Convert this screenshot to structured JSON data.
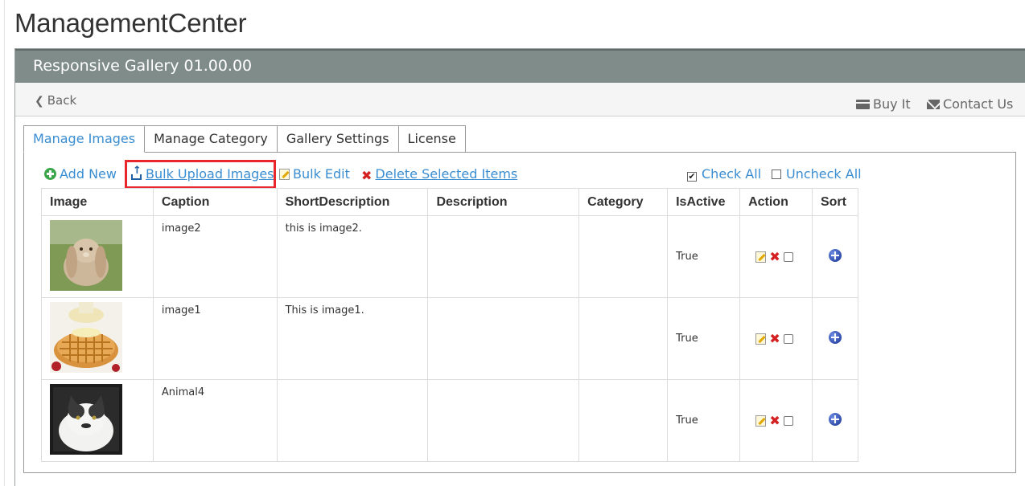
{
  "app": {
    "title": "ManagementCenter"
  },
  "module": {
    "title": "Responsive Gallery 01.00.00"
  },
  "toolbar": {
    "back": "Back",
    "buy": "Buy It",
    "contact": "Contact Us"
  },
  "tabs": [
    {
      "label": "Manage Images",
      "active": true
    },
    {
      "label": "Manage Category",
      "active": false
    },
    {
      "label": "Gallery Settings",
      "active": false
    },
    {
      "label": "License",
      "active": false
    }
  ],
  "actions": {
    "add_new": "Add New",
    "bulk_upload": "Bulk Upload Images",
    "bulk_edit": "Bulk Edit",
    "delete_selected": "Delete Selected Items",
    "check_all": "Check All",
    "uncheck_all": "Uncheck All"
  },
  "table": {
    "headers": [
      "Image",
      "Caption",
      "ShortDescription",
      "Description",
      "Category",
      "IsActive",
      "Action",
      "Sort"
    ],
    "rows": [
      {
        "image": "rabbit",
        "caption": "image2",
        "short": "this is image2.",
        "description": "",
        "category": "",
        "active": "True"
      },
      {
        "image": "waffle",
        "caption": "image1",
        "short": "This is image1.",
        "description": "",
        "category": "",
        "active": "True"
      },
      {
        "image": "cat",
        "caption": "Animal4",
        "short": "",
        "description": "",
        "category": "",
        "active": "True"
      }
    ]
  },
  "colors": {
    "header_bar": "#7f8c8a",
    "link": "#3a8dd1",
    "highlight": "#e8262b"
  }
}
